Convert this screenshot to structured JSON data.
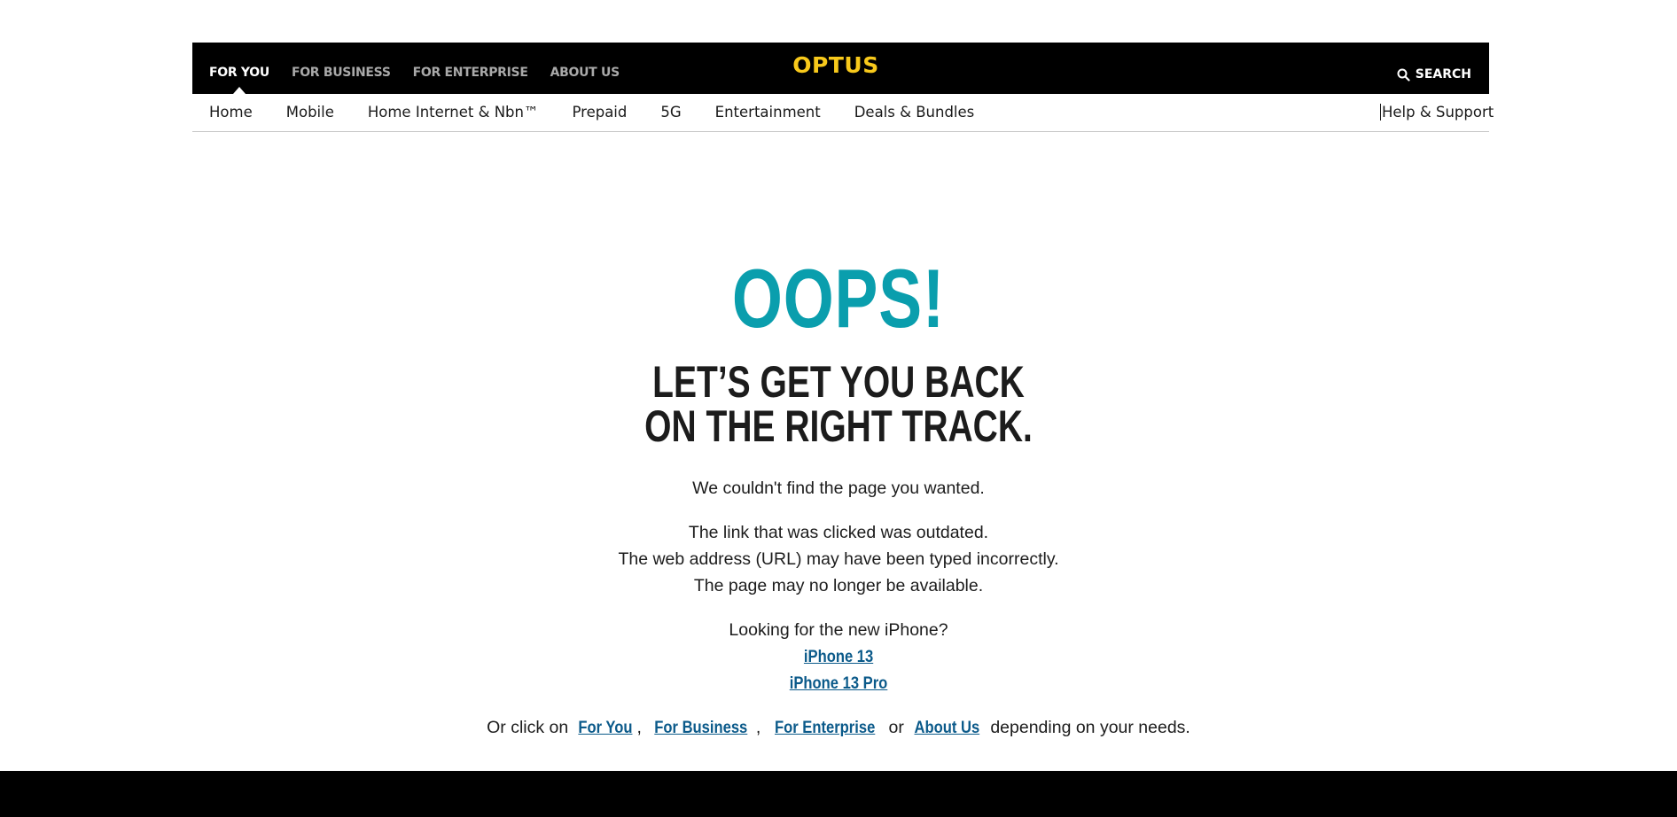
{
  "header": {
    "segments": [
      {
        "label": "FOR YOU",
        "active": true
      },
      {
        "label": "FOR BUSINESS",
        "active": false
      },
      {
        "label": "FOR ENTERPRISE",
        "active": false
      },
      {
        "label": "ABOUT US",
        "active": false
      }
    ],
    "logo": "OPTUS",
    "search_label": "SEARCH"
  },
  "nav": {
    "items": [
      "Home",
      "Mobile",
      "Home Internet & Nbn™",
      "Prepaid",
      "5G",
      "Entertainment",
      "Deals & Bundles"
    ],
    "help": "Help & Support"
  },
  "main": {
    "title": "OOPS!",
    "subtitle_line1": "LET’S GET YOU BACK",
    "subtitle_line2": "ON THE RIGHT TRACK.",
    "not_found": "We couldn't find the page you wanted.",
    "reasons": [
      "The link that was clicked was outdated.",
      "The web address (URL) may have been typed incorrectly.",
      "The page may no longer be available."
    ],
    "iphone_prompt": "Looking for the new iPhone?",
    "iphone_links": [
      "iPhone 13",
      "iPhone 13 Pro"
    ],
    "or_click": "Or click on",
    "segment_links": [
      "For You",
      "For Business",
      "For Enterprise",
      "About Us"
    ],
    "comma": ",",
    "or": "or",
    "depending": "depending on your needs."
  },
  "colors": {
    "brand_yellow": "#f8c91b",
    "accent_teal": "#0a9ead",
    "link_blue": "#0b5a8a"
  }
}
